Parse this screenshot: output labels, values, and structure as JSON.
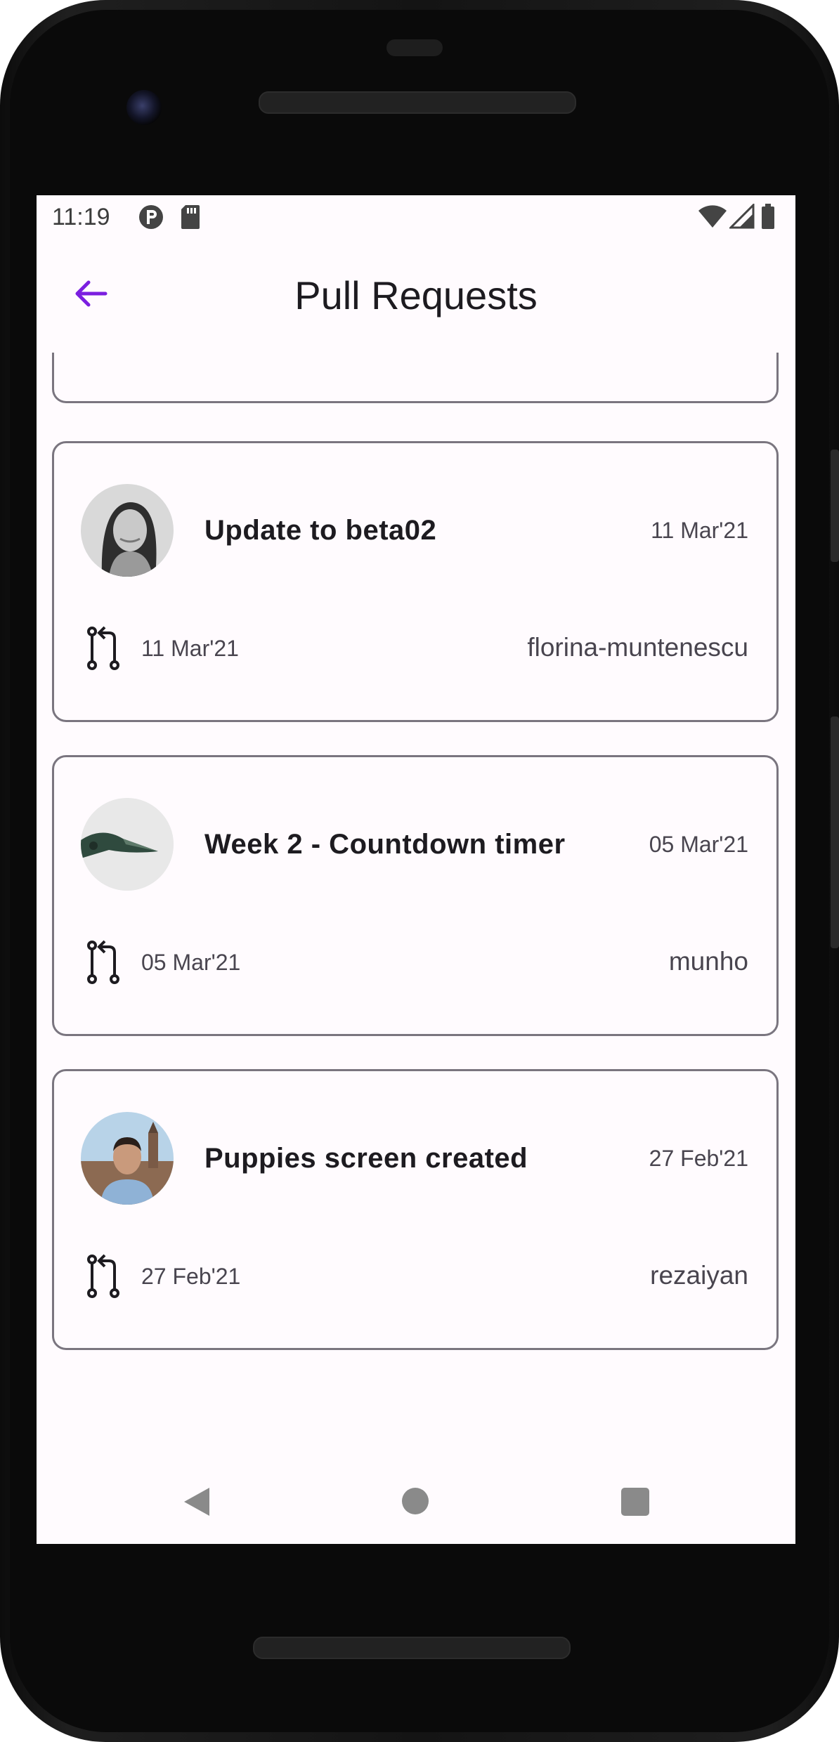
{
  "status_bar": {
    "time": "11:19",
    "icons": [
      "notification-icon",
      "sd-card-icon",
      "wifi-icon",
      "signal-icon",
      "battery-icon"
    ]
  },
  "app_bar": {
    "title": "Pull Requests",
    "back_icon": "arrow-back-icon"
  },
  "colors": {
    "accent": "#7b1fe0",
    "card_border": "#7a757f",
    "background": "#fffbfe",
    "text_primary": "#1d1b20",
    "text_secondary": "#49454f"
  },
  "pull_requests": [
    {
      "title": "Update to beta02",
      "date_top": "11 Mar'21",
      "date_bottom": "11 Mar'21",
      "user": "florina-muntenescu",
      "avatar": "avatar-photo-woman"
    },
    {
      "title": "Week 2 - Countdown timer",
      "date_top": "05 Mar'21",
      "date_bottom": "05 Mar'21",
      "user": "munho",
      "avatar": "avatar-photo-bird"
    },
    {
      "title": "Puppies screen created",
      "date_top": "27 Feb'21",
      "date_bottom": "27 Feb'21",
      "user": "rezaiyan",
      "avatar": "avatar-photo-man"
    }
  ],
  "nav_bar": {
    "buttons": [
      "nav-back-icon",
      "nav-home-icon",
      "nav-recents-icon"
    ]
  }
}
